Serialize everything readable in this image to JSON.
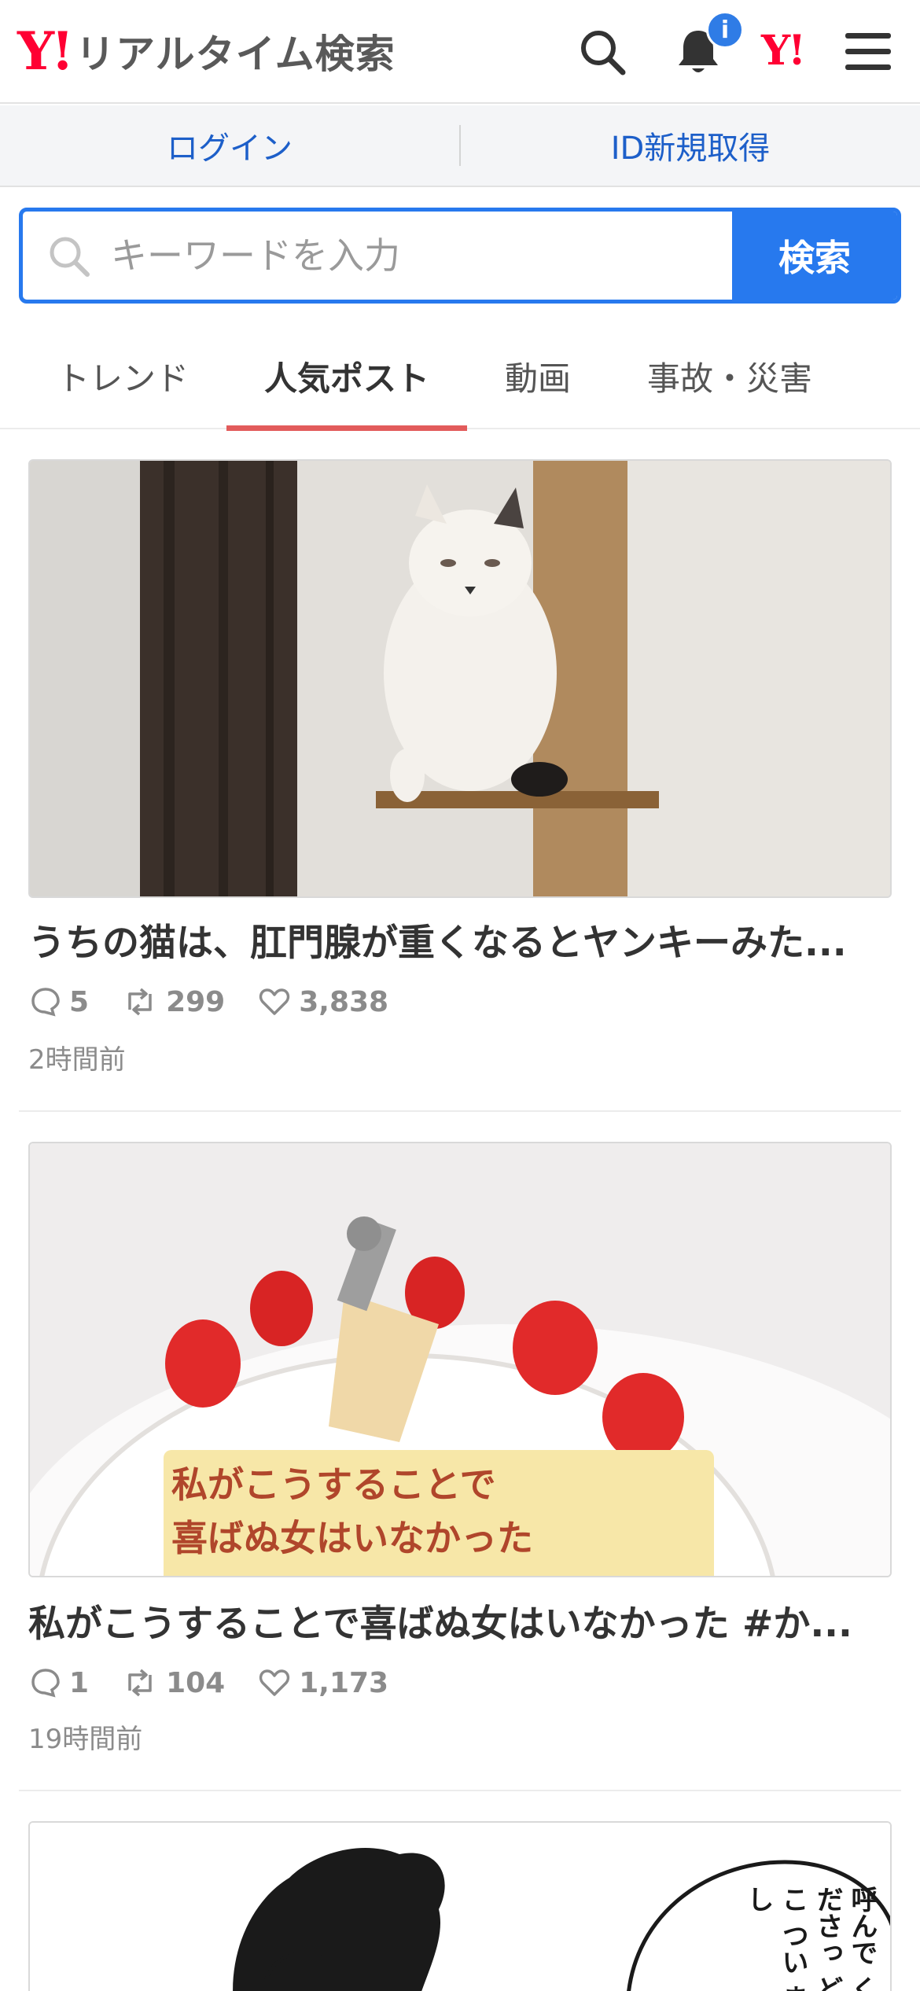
{
  "header": {
    "logo_mark": "Y!",
    "logo_text": "リアルタイム検索",
    "notification_badge": "i",
    "yj_mark": "Y!"
  },
  "login_bar": {
    "login_label": "ログイン",
    "signup_label": "ID新規取得"
  },
  "search": {
    "placeholder": "キーワードを入力",
    "button_label": "検索"
  },
  "tabs": [
    {
      "label": "トレンド",
      "active": false
    },
    {
      "label": "人気ポスト",
      "active": true
    },
    {
      "label": "動画",
      "active": false
    },
    {
      "label": "事故・災害",
      "active": false
    }
  ],
  "posts": [
    {
      "title": "うちの猫は、肛門腺が重くなるとヤンキーみた...",
      "replies": "5",
      "reposts": "299",
      "likes": "3,838",
      "time": "2時間前"
    },
    {
      "title": "私がこうすることで喜ばぬ女はいなかった #か...",
      "cake_text_line1": "私がこうすることで",
      "cake_text_line2": "喜ばぬ女はいなかった",
      "replies": "1",
      "reposts": "104",
      "likes": "1,173",
      "time": "19時間前"
    },
    {
      "speech_text": "呼んで くださっ どこ つい まし"
    }
  ],
  "colors": {
    "brand_red": "#ff0033",
    "accent_blue": "#2779ee",
    "link_blue": "#1d5fc9",
    "tab_underline": "#e25b5b"
  }
}
